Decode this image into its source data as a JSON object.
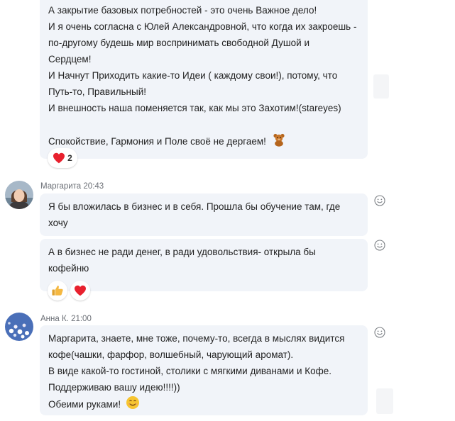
{
  "messages": [
    {
      "lines": [
        "А закрытие базовых потребностей - это очень Важное дело!",
        "И я очень согласна с Юлей Александровной, что когда их закроешь -",
        "по-другому будешь мир воспринимать свободной Душой и",
        "Сердцем!",
        "И Начнут Приходить какие-то Идеи ( каждому свои!), потому, что",
        "Путь-то, Правильный!",
        "И внешность наша поменяется так, как  мы это Захотим!(stareyes)",
        "",
        "Спокойствие, Гармония и Поле своё не дергаем!"
      ],
      "trailing_emoji": "teddy-bear-emoji",
      "reactions": [
        {
          "emoji": "heart",
          "count": "2"
        }
      ]
    },
    {
      "sender": "Маргарита",
      "time": "20:43",
      "bubbles": [
        {
          "lines": [
            "Я бы вложилась в бизнес и в себя. Прошла бы обучение там, где",
            "хочу"
          ]
        },
        {
          "lines": [
            "А в бизнес не ради денег, в ради удовольствия- открыла бы",
            "кофейню"
          ]
        }
      ],
      "reactions": [
        {
          "emoji": "thumbs-up"
        },
        {
          "emoji": "heart"
        }
      ]
    },
    {
      "sender": "Анна К.",
      "time": "21:00",
      "lines": [
        "Маргарита, знаете, мне тоже, почему-то, всегда в мыслях видится",
        "кофе(чашки, фарфор, волшебный, чарующий аромат).",
        "В виде какой-то гостиной, столики с мягкими диванами  и Кофе.",
        "Поддерживаю вашу идею!!!!))",
        "Обеими руками!"
      ],
      "trailing_emoji": "smiling-face-emoji"
    }
  ],
  "colors": {
    "bubble": "#f1f4f9",
    "heart": "#e8212e",
    "thumb": "#f5b841",
    "meta": "#6b6f76"
  }
}
